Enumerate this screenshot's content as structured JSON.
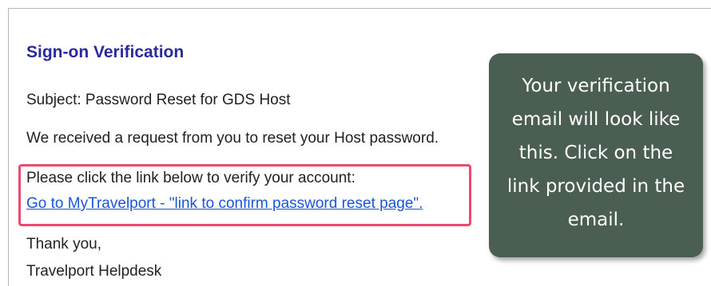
{
  "email": {
    "heading": "Sign-on Verification",
    "subject_line": "Subject: Password Reset for GDS Host",
    "received_line": "We received a request from you to reset your Host password.",
    "instruction_line": "Please click the link below to verify your account:",
    "verification_link": "Go to MyTravelport - \"link to confirm password reset page\".",
    "closing_line": "Thank you,",
    "signature": "Travelport Helpdesk"
  },
  "callout": {
    "lines": [
      "Your verification",
      "email will look like",
      "this. Click on the",
      "link provided in the",
      "email."
    ]
  },
  "colors": {
    "heading": "#2b2a9c",
    "link": "#1a55d8",
    "highlight_border": "#ec4a6a",
    "callout_background": "#4b5e52"
  }
}
